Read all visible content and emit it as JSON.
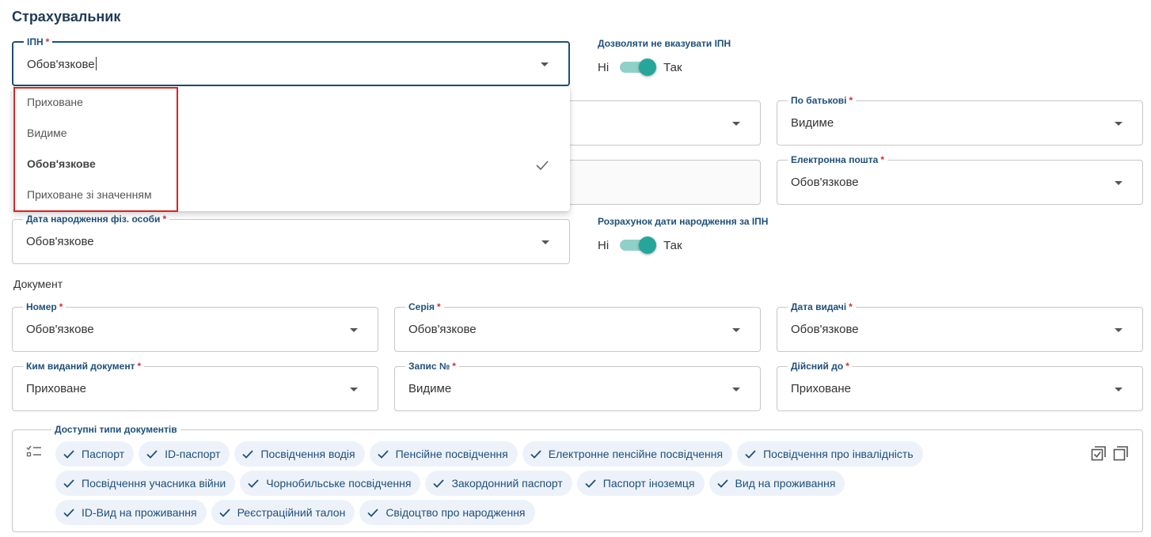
{
  "section_title": "Страхувальник",
  "ipn": {
    "label": "ІПН",
    "required_mark": "*",
    "value": "Обов'язкове"
  },
  "dropdown": {
    "options": [
      {
        "label": "Приховане",
        "selected": false
      },
      {
        "label": "Видиме",
        "selected": false
      },
      {
        "label": "Обов'язкове",
        "selected": true
      },
      {
        "label": "Приховане зі значенням",
        "selected": false
      }
    ]
  },
  "allow_no_ipn": {
    "label": "Дозволяти не вказувати ІПН",
    "off": "Ні",
    "on": "Так",
    "checked": true
  },
  "patronymic": {
    "label": "По батькові",
    "required_mark": "*",
    "value": "Видиме"
  },
  "email": {
    "label": "Електронна пошта",
    "required_mark": "*",
    "value": "Обов'язкове"
  },
  "birth_date": {
    "label": "Дата народження фіз. особи",
    "required_mark": "*",
    "value": "Обов'язкове"
  },
  "birth_calc": {
    "label": "Розрахунок дати народження за ІПН",
    "off": "Ні",
    "on": "Так",
    "checked": true
  },
  "document": {
    "heading": "Документ",
    "number": {
      "label": "Номер",
      "required_mark": "*",
      "value": "Обов'язкове"
    },
    "series": {
      "label": "Серія",
      "required_mark": "*",
      "value": "Обов'язкове"
    },
    "issue_date": {
      "label": "Дата видачі",
      "required_mark": "*",
      "value": "Обов'язкове"
    },
    "issued_by": {
      "label": "Ким виданий документ",
      "required_mark": "*",
      "value": "Приховане"
    },
    "record_no": {
      "label": "Запис №",
      "required_mark": "*",
      "value": "Видиме"
    },
    "valid_until": {
      "label": "Дійсний до",
      "required_mark": "*",
      "value": "Приховане"
    }
  },
  "doc_types": {
    "label": "Доступні типи документів",
    "chips": [
      "Паспорт",
      "ID-паспорт",
      "Посвідчення водія",
      "Пенсійне посвідчення",
      "Електронне пенсійне посвідчення",
      "Посвідчення про інвалідність",
      "Посвідчення учасника війни",
      "Чорнобильське посвідчення",
      "Закордонний паспорт",
      "Паспорт іноземця",
      "Вид на проживання",
      "ID-Вид на проживання",
      "Реєстраційний талон",
      "Свідоцтво про народження"
    ]
  },
  "colors": {
    "accent": "#1d4f7a",
    "toggle": "#26a69a",
    "chip_bg": "#edf2fa",
    "highlight": "#e02020"
  }
}
